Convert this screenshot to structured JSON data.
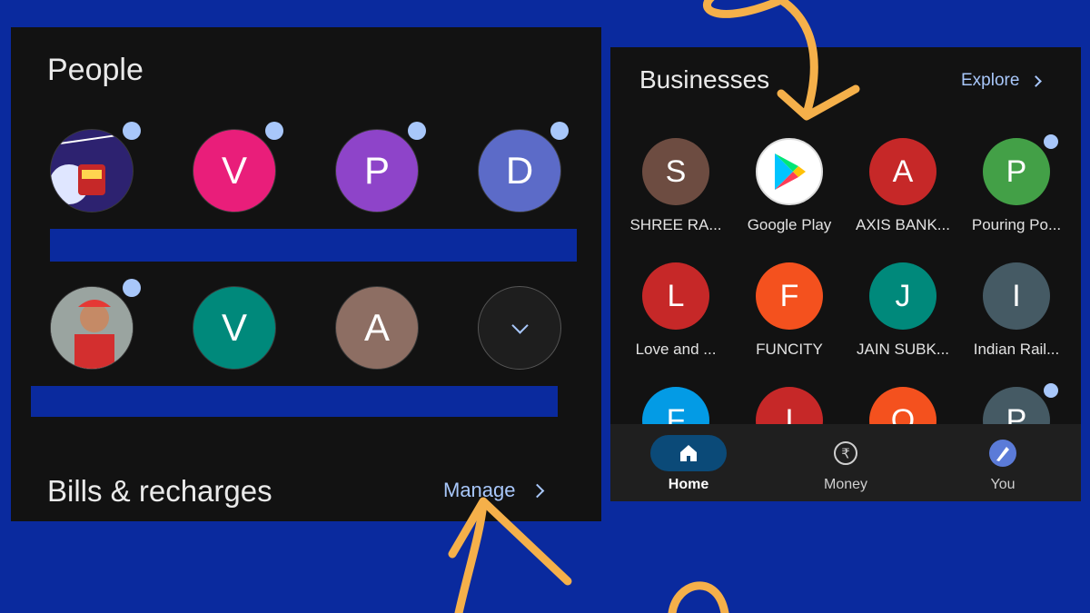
{
  "people": {
    "title": "People",
    "row1": [
      {
        "letter": "",
        "color": "#2b1f6b",
        "photo": true,
        "dot": true
      },
      {
        "letter": "V",
        "color": "#e91e7a",
        "dot": true
      },
      {
        "letter": "P",
        "color": "#8e44c9",
        "dot": true
      },
      {
        "letter": "D",
        "color": "#5c6bc8",
        "dot": true
      }
    ],
    "row2": [
      {
        "letter": "",
        "color": "#b0b0b0",
        "photo": true,
        "dot": true
      },
      {
        "letter": "V",
        "color": "#00897b",
        "dot": false
      },
      {
        "letter": "A",
        "color": "#8d6e63",
        "dot": false
      }
    ],
    "expand_icon": "chevron-down-icon"
  },
  "bills": {
    "title": "Bills & recharges",
    "manage_label": "Manage"
  },
  "businesses": {
    "title": "Businesses",
    "explore_label": "Explore",
    "items": [
      {
        "letter": "S",
        "label": "SHREE RA...",
        "color": "#6d4c41",
        "dot": false
      },
      {
        "letter": "",
        "label": "Google Play",
        "color": "#ffffff",
        "logo": "google-play",
        "dot": false
      },
      {
        "letter": "A",
        "label": "AXIS BANK...",
        "color": "#c62828",
        "dot": false
      },
      {
        "letter": "P",
        "label": "Pouring Po...",
        "color": "#43a047",
        "dot": true
      },
      {
        "letter": "L",
        "label": "Love and ...",
        "color": "#c62828",
        "dot": false
      },
      {
        "letter": "F",
        "label": "FUNCITY",
        "color": "#f4511e",
        "dot": false
      },
      {
        "letter": "J",
        "label": "JAIN SUBK...",
        "color": "#00897b",
        "dot": false
      },
      {
        "letter": "I",
        "label": "Indian Rail...",
        "color": "#455a64",
        "dot": false
      },
      {
        "letter": "F",
        "label": "",
        "color": "#039be5",
        "dot": false
      },
      {
        "letter": "I",
        "label": "",
        "color": "#c62828",
        "dot": false
      },
      {
        "letter": "O",
        "label": "",
        "color": "#f4511e",
        "dot": false
      },
      {
        "letter": "P",
        "label": "",
        "color": "#455a64",
        "dot": true
      }
    ]
  },
  "nav": {
    "items": [
      {
        "label": "Home",
        "icon": "home-icon",
        "active": true
      },
      {
        "label": "Money",
        "icon": "rupee-icon",
        "active": false
      },
      {
        "label": "You",
        "icon": "profile-icon",
        "active": false
      }
    ]
  },
  "colors": {
    "background": "#0a2a9e",
    "panel": "#121212",
    "accent": "#a8c7fa",
    "arrow": "#f5b04a"
  }
}
